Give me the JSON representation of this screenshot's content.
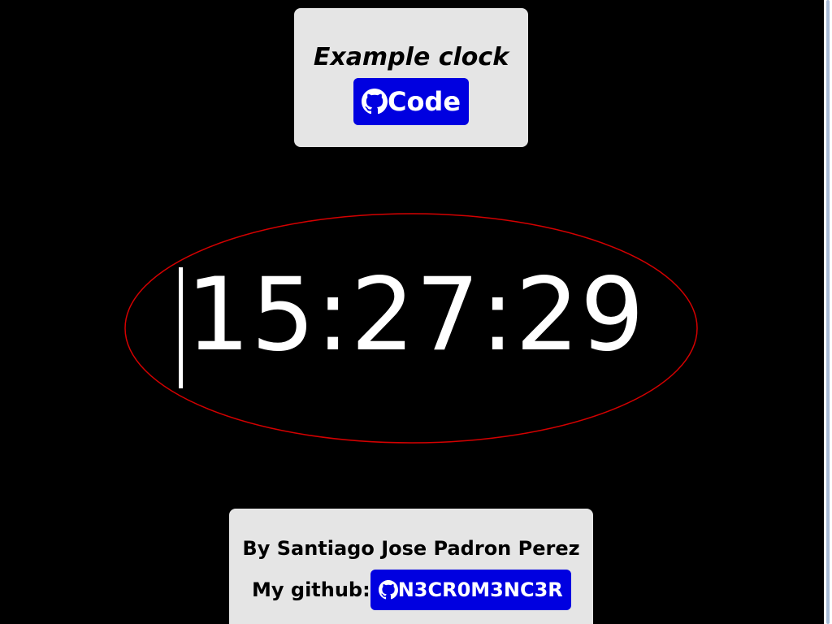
{
  "header": {
    "title": "Example clock",
    "code_button_label": "Code"
  },
  "clock": {
    "time": "15:27:29"
  },
  "footer": {
    "author": "By Santiago Jose Padron Perez",
    "github_label": "My github:",
    "github_username": "N3CR0M3NC3R"
  },
  "colors": {
    "background": "#000000",
    "card": "#e5e5e5",
    "button": "#0000e0",
    "ellipse": "#d40000",
    "clock_text": "#ffffff"
  },
  "icons": {
    "code_button_icon": "github-icon",
    "profile_button_icon": "github-icon"
  }
}
